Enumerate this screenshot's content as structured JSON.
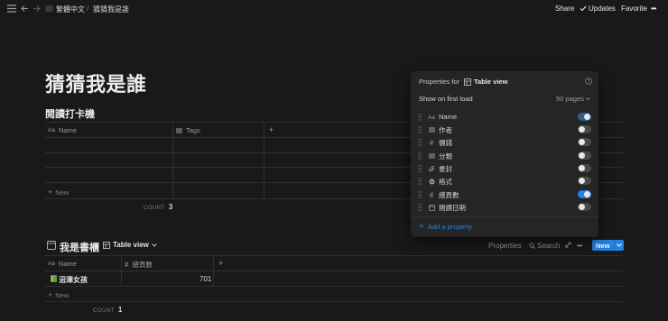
{
  "topbar": {
    "breadcrumb_parent": "繁體中文",
    "separator": "/",
    "breadcrumb_current": "猜猜我是誰",
    "share": "Share",
    "updates": "Updates",
    "favorite": "Favorite",
    "more": "•••"
  },
  "page": {
    "title": "猜猜我是誰"
  },
  "db1": {
    "title": "閱讀打卡機",
    "columns": [
      "Name",
      "Tags"
    ],
    "add_column": "+",
    "new_label": "New",
    "count_label": "COUNT",
    "count_value": "3"
  },
  "db2": {
    "title": "我是書櫃",
    "view_name": "Table view",
    "toolbar": {
      "properties": "Properties",
      "search": "Search",
      "new": "New"
    },
    "columns": [
      "Name",
      "總頁數"
    ],
    "add_column": "+",
    "rows": [
      {
        "name": "沼澤女孩",
        "pages": "701"
      }
    ],
    "new_label": "New",
    "count_label": "COUNT",
    "count_value": "1"
  },
  "properties_panel": {
    "heading_prefix": "Properties for",
    "heading_view": "Table view",
    "show_on_first_load_label": "Show on first load",
    "show_on_first_load_value": "50 pages",
    "properties": [
      {
        "label": "Name",
        "icon": "text-icon",
        "visible": true
      },
      {
        "label": "作者",
        "icon": "list-icon",
        "visible": false
      },
      {
        "label": "價錢",
        "icon": "number-icon",
        "visible": false
      },
      {
        "label": "分類",
        "icon": "list-icon",
        "visible": false
      },
      {
        "label": "書封",
        "icon": "attachment-icon",
        "visible": false
      },
      {
        "label": "格式",
        "icon": "select-icon",
        "visible": false
      },
      {
        "label": "總頁數",
        "icon": "number-icon",
        "visible": true
      },
      {
        "label": "閱讀日期",
        "icon": "date-icon",
        "visible": false
      }
    ],
    "add_property": "Add a property"
  },
  "colors": {
    "accent": "#2383e2",
    "background": "#191919",
    "panel": "#252525"
  }
}
